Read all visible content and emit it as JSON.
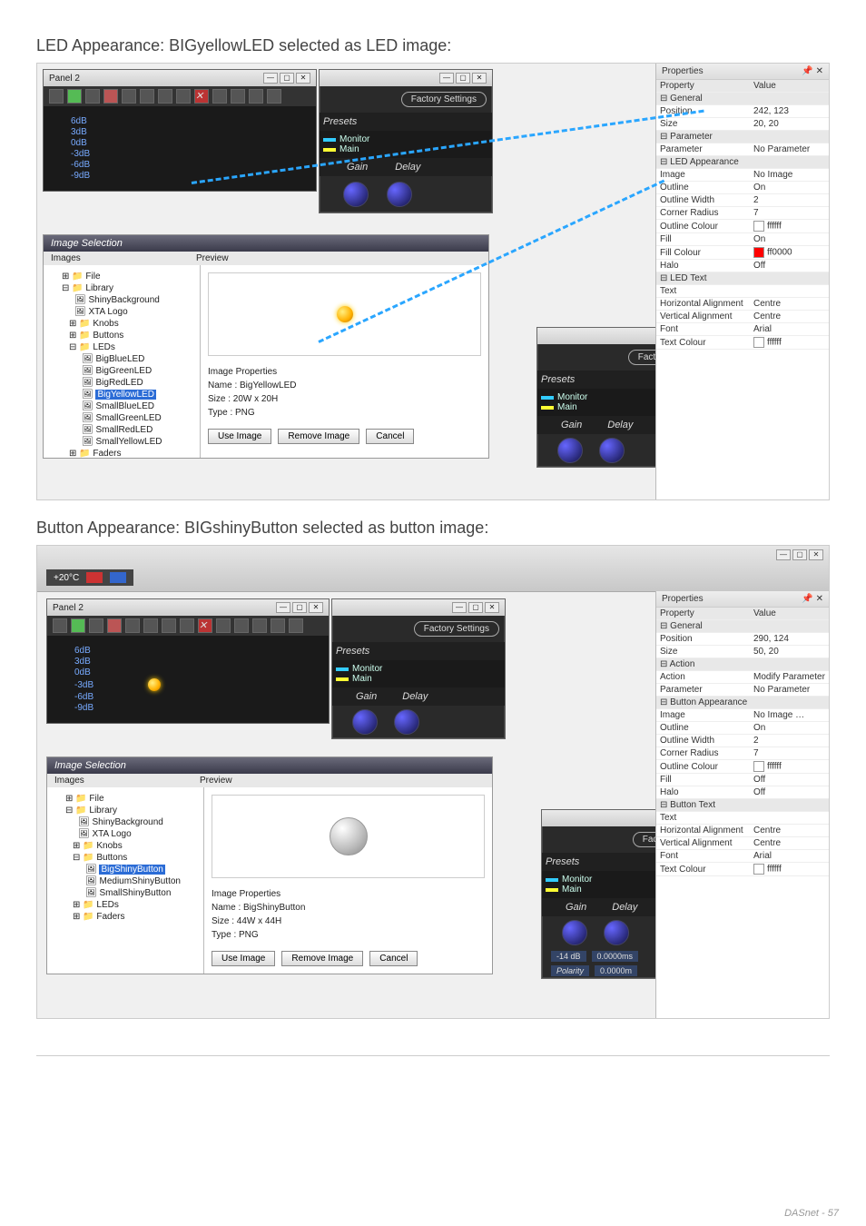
{
  "headings": {
    "h1": "LED Appearance: BIGyellowLED selected as LED image:",
    "h2": "Button Appearance: BIGshinyButton selected as button image:"
  },
  "footer": "DASnet - 57",
  "common": {
    "panelTitle": "Panel 2",
    "factorySettings": "Factory Settings",
    "presets": "Presets",
    "monitor": "Monitor",
    "main": "Main",
    "gain": "Gain",
    "delay": "Delay",
    "imageSelection": "Image Selection",
    "imagesLabel": "Images",
    "previewLabel": "Preview",
    "imagePropertiesLabel": "Image Properties",
    "useImage": "Use Image",
    "removeImage": "Remove Image",
    "cancel": "Cancel",
    "propertiesTitle": "Properties",
    "propertyCol": "Property",
    "valueCol": "Value",
    "db": [
      "6dB",
      "3dB",
      "0dB",
      "-3dB",
      "-6dB",
      "-9dB"
    ]
  },
  "shot1": {
    "tree": {
      "file": "File",
      "library": "Library",
      "items": [
        "ShinyBackground",
        "XTA Logo"
      ],
      "knobs": "Knobs",
      "buttons": "Buttons",
      "leds": "LEDs",
      "ledItems": [
        "BigBlueLED",
        "BigGreenLED",
        "BigRedLED",
        "BigYellowLED",
        "SmallBlueLED",
        "SmallGreenLED",
        "SmallRedLED",
        "SmallYellowLED"
      ],
      "selected": "BigYellowLED",
      "faders": "Faders"
    },
    "imgProps": {
      "name": "Name : BigYellowLED",
      "size": "Size : 20W x 20H",
      "type": "Type : PNG"
    },
    "props": {
      "groups": {
        "general": "General",
        "parameter": "Parameter",
        "ledApp": "LED Appearance",
        "ledText": "LED Text"
      },
      "rows": {
        "position": {
          "k": "Position",
          "v": "242, 123"
        },
        "size": {
          "k": "Size",
          "v": "20, 20"
        },
        "parameter": {
          "k": "Parameter",
          "v": "No Parameter"
        },
        "image": {
          "k": "Image",
          "v": "No Image"
        },
        "outline": {
          "k": "Outline",
          "v": "On"
        },
        "outlineWidth": {
          "k": "Outline Width",
          "v": "2"
        },
        "cornerRadius": {
          "k": "Corner Radius",
          "v": "7"
        },
        "outlineColour": {
          "k": "Outline Colour",
          "v": "ffffff"
        },
        "fill": {
          "k": "Fill",
          "v": "On"
        },
        "fillColour": {
          "k": "Fill Colour",
          "v": "ff0000"
        },
        "halo": {
          "k": "Halo",
          "v": "Off"
        },
        "text": {
          "k": "Text",
          "v": ""
        },
        "hAlign": {
          "k": "Horizontal Alignment",
          "v": "Centre"
        },
        "vAlign": {
          "k": "Vertical Alignment",
          "v": "Centre"
        },
        "font": {
          "k": "Font",
          "v": "Arial"
        },
        "textColour": {
          "k": "Text Colour",
          "v": "ffffff"
        }
      }
    }
  },
  "shot2": {
    "toolbarTemp": "+20°C",
    "tree": {
      "file": "File",
      "library": "Library",
      "items": [
        "ShinyBackground",
        "XTA Logo"
      ],
      "knobs": "Knobs",
      "buttons": "Buttons",
      "buttonItems": [
        "BigShinyButton",
        "MediumShinyButton",
        "SmallShinyButton"
      ],
      "selected": "BigShinyButton",
      "leds": "LEDs",
      "faders": "Faders"
    },
    "imgProps": {
      "name": "Name : BigShinyButton",
      "size": "Size : 44W x 44H",
      "type": "Type : PNG"
    },
    "miniExtra": {
      "polarity": "Polarity",
      "gainVal": "-14 dB",
      "delayVal": "0.0000ms",
      "delayVal2": "0.0000m"
    },
    "props": {
      "groups": {
        "general": "General",
        "action": "Action",
        "btnApp": "Button Appearance",
        "btnText": "Button Text"
      },
      "rows": {
        "position": {
          "k": "Position",
          "v": "290, 124"
        },
        "size": {
          "k": "Size",
          "v": "50, 20"
        },
        "action": {
          "k": "Action",
          "v": "Modify Parameter"
        },
        "parameter": {
          "k": "Parameter",
          "v": "No Parameter"
        },
        "image": {
          "k": "Image",
          "v": "No Image"
        },
        "outline": {
          "k": "Outline",
          "v": "On"
        },
        "outlineWidth": {
          "k": "Outline Width",
          "v": "2"
        },
        "cornerRadius": {
          "k": "Corner Radius",
          "v": "7"
        },
        "outlineColour": {
          "k": "Outline Colour",
          "v": "ffffff"
        },
        "fill": {
          "k": "Fill",
          "v": "Off"
        },
        "halo": {
          "k": "Halo",
          "v": "Off"
        },
        "text": {
          "k": "Text",
          "v": ""
        },
        "hAlign": {
          "k": "Horizontal Alignment",
          "v": "Centre"
        },
        "vAlign": {
          "k": "Vertical Alignment",
          "v": "Centre"
        },
        "font": {
          "k": "Font",
          "v": "Arial"
        },
        "textColour": {
          "k": "Text Colour",
          "v": "ffffff"
        }
      }
    }
  }
}
